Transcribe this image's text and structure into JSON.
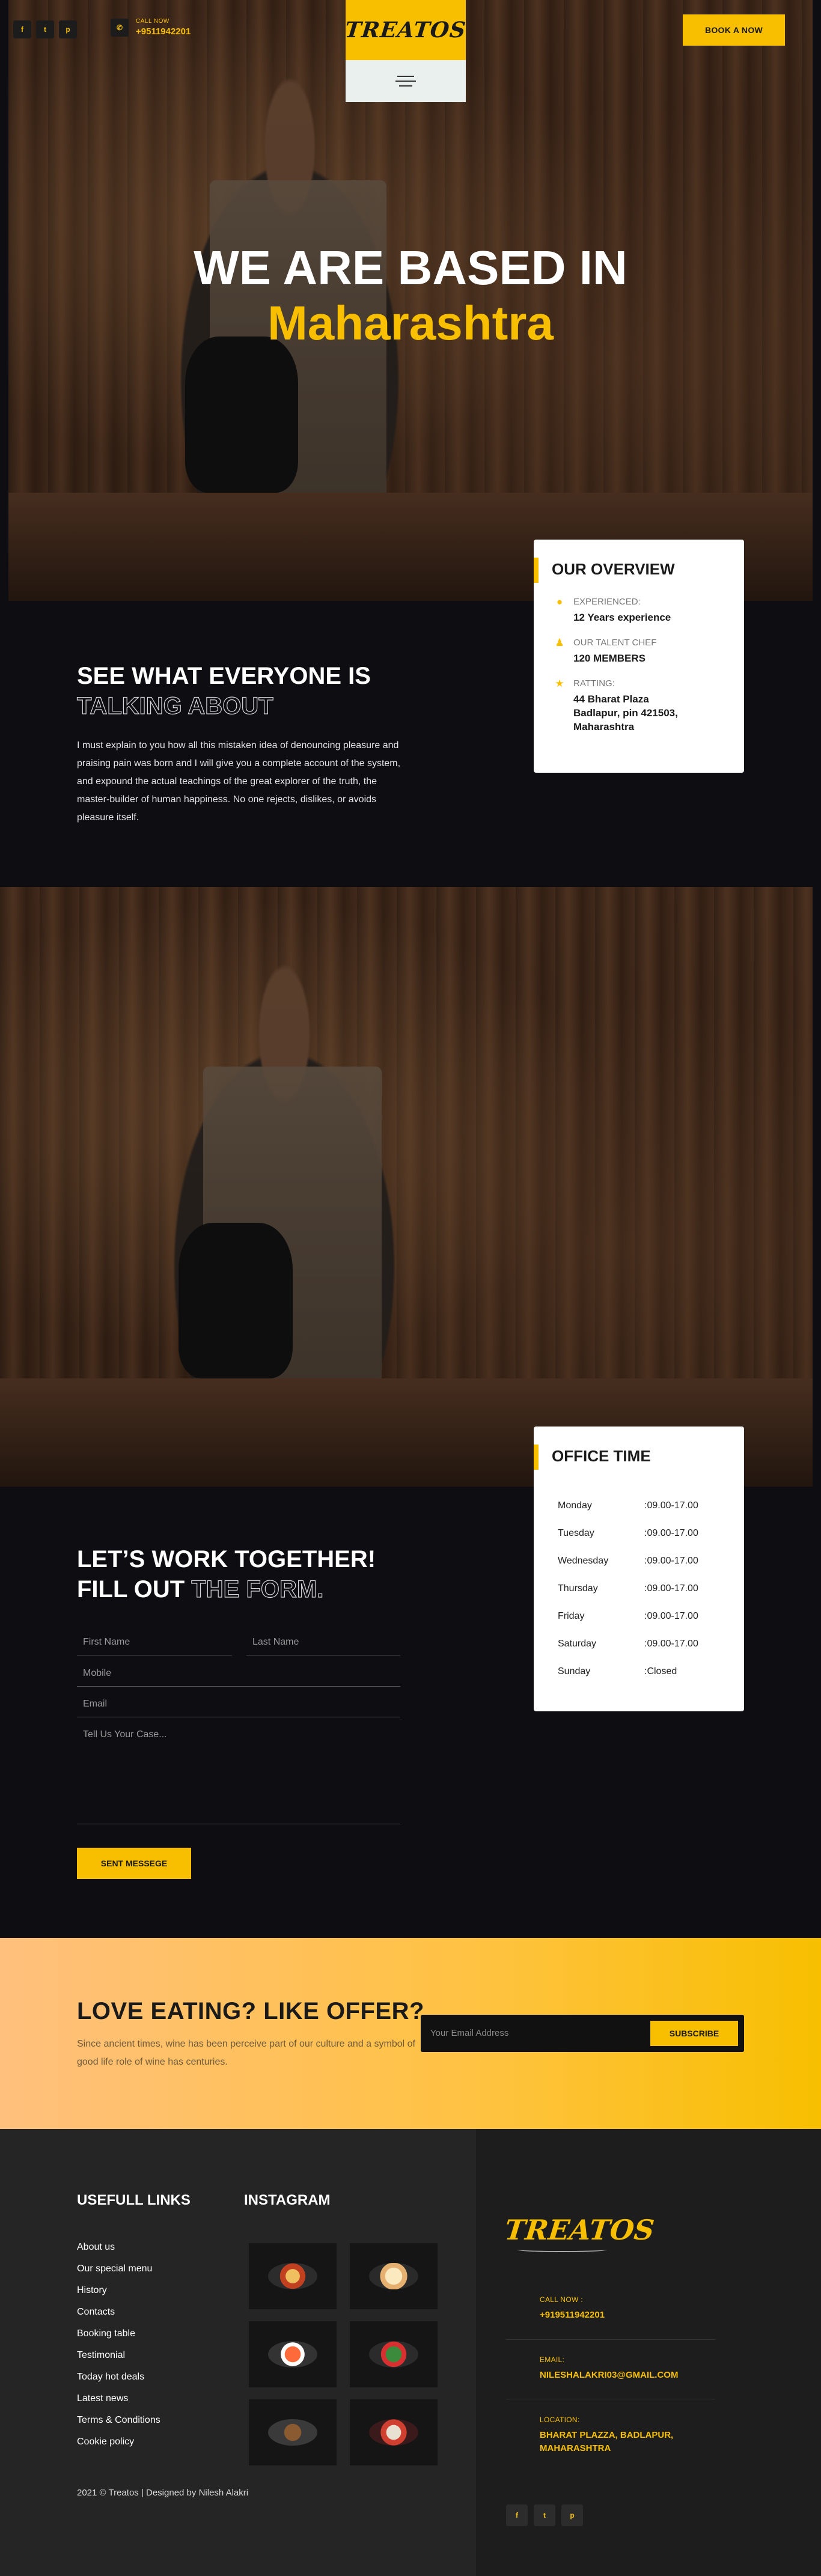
{
  "colors": {
    "accent": "#f7bf00",
    "dark_bg": "#0d0d12",
    "footer_bg": "#252525"
  },
  "header": {
    "social": [
      {
        "name": "facebook-icon",
        "glyph": "f"
      },
      {
        "name": "twitter-icon",
        "glyph": "t"
      },
      {
        "name": "pinterest-icon",
        "glyph": "p"
      }
    ],
    "call_label": "CALL NOW",
    "call_number": "+9511942201",
    "logo": "TREATOS",
    "book_label": "BOOK A NOW"
  },
  "hero": {
    "line1": "WE ARE BASED IN",
    "line2": "Maharashtra"
  },
  "overview": {
    "title": "OUR OVERVIEW",
    "items": [
      {
        "icon": "circle-icon",
        "label": "EXPERIENCED:",
        "value": "12 Years experience"
      },
      {
        "icon": "user-icon",
        "label": "OUR TALENT CHEF",
        "value": "120 MEMBERS"
      },
      {
        "icon": "star-icon",
        "label": "RATTING:",
        "value": "44 Bharat Plaza Badlapur, pin 421503, Maharashtra"
      }
    ]
  },
  "testimonial": {
    "title_line1": "SEE WHAT EVERYONE IS",
    "title_line2": "TALKING ABOUT",
    "text": "I must explain to you how all this mistaken idea of denouncing pleasure and praising pain was born and I will give you a complete account of the system, and expound the actual teachings of the great explorer of the truth, the master-builder of human happiness. No one rejects, dislikes, or avoids pleasure itself."
  },
  "office": {
    "title": "OFFICE TIME",
    "rows": [
      {
        "day": "Monday",
        "time": ":09.00-17.00"
      },
      {
        "day": "Tuesday",
        "time": ":09.00-17.00"
      },
      {
        "day": "Wednesday",
        "time": ":09.00-17.00"
      },
      {
        "day": "Thursday",
        "time": ":09.00-17.00"
      },
      {
        "day": "Friday",
        "time": ":09.00-17.00"
      },
      {
        "day": "Saturday",
        "time": ":09.00-17.00"
      },
      {
        "day": "Sunday",
        "time": ":Closed"
      }
    ]
  },
  "form": {
    "title_line1": "LET’S WORK TOGETHER!",
    "title_line2a": "FILL OUT ",
    "title_line2b": "THE FORM.",
    "first_name": "First Name",
    "last_name": "Last Name",
    "mobile": "Mobile",
    "email": "Email",
    "message": "Tell Us Your Case...",
    "send": "SENT MESSEGE"
  },
  "offer": {
    "title": "LOVE EATING? LIKE OFFER?",
    "text": "Since ancient times, wine has been perceive part of our culture and a symbol of good life role of wine has centuries.",
    "placeholder": "Your Email Address",
    "button": "SUBSCRIBE"
  },
  "footer": {
    "links_title": "USEFULL LINKS",
    "links": [
      "About us",
      "Our special menu",
      "History",
      "Contacts",
      "Booking table",
      "Testimonial",
      "Today hot deals",
      "Latest news",
      "Terms & Conditions",
      "Cookie policy"
    ],
    "instagram_title": "INSTAGRAM",
    "copyright": "2021 © Treatos | Designed by Nilesh Alakri",
    "logo": "TREATOS",
    "call_label": "CALL NOW :",
    "call_value": "+919511942201",
    "email_label": "EMAIL:",
    "email_value": "NILESHALAKRI03@GMAIL.COM",
    "location_label": "LOCATION:",
    "location_value": "BHARAT PLAZZA, BADLAPUR, MAHARASHTRA"
  }
}
